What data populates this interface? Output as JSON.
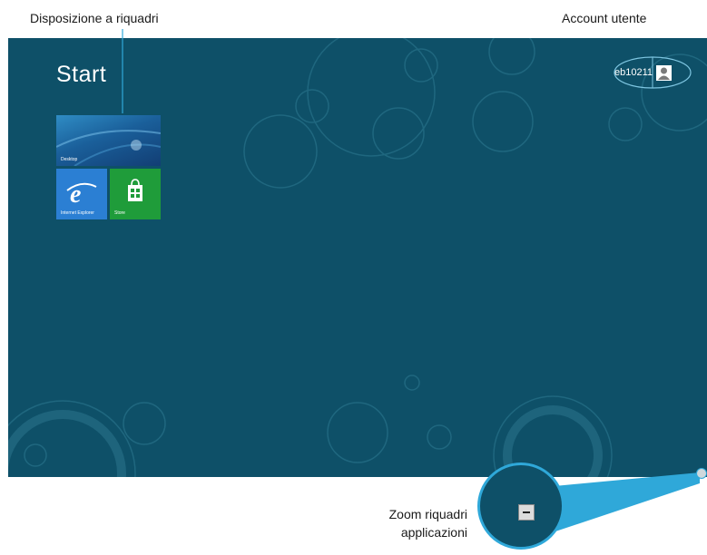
{
  "callouts": {
    "tiles": "Disposizione a riquadri",
    "account": "Account utente",
    "zoom_line1": "Zoom riquadri",
    "zoom_line2": "applicazioni"
  },
  "start": {
    "title": "Start"
  },
  "tiles": [
    {
      "label": "Desktop",
      "icon": "desktop-wallpaper",
      "color": "#1a5f9a"
    },
    {
      "label": "Internet Explorer",
      "icon": "internet-explorer-icon",
      "color": "#2b7fd3"
    },
    {
      "label": "Store",
      "icon": "store-bag-icon",
      "color": "#1f9c3a"
    }
  ],
  "user": {
    "name": "eb10211",
    "icon": "user-avatar-icon"
  },
  "zoom": {
    "icon": "minus-icon"
  },
  "colors": {
    "background": "#0e5068",
    "callout_line": "#2fa8d9"
  }
}
